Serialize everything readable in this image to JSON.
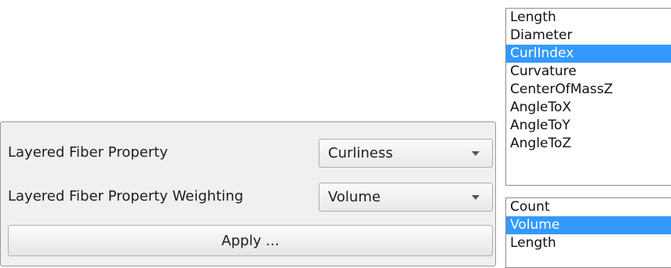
{
  "panel": {
    "property_label": "Layered Fiber Property",
    "property_value": "Curliness",
    "weighting_label": "Layered Fiber Property Weighting",
    "weighting_value": "Volume",
    "apply_label": "Apply ..."
  },
  "property_list": {
    "items": [
      "Length",
      "Diameter",
      "CurlIndex",
      "Curvature",
      "CenterOfMassZ",
      "AngleToX",
      "AngleToY",
      "AngleToZ"
    ],
    "selected": "CurlIndex"
  },
  "weighting_list": {
    "items": [
      "Count",
      "Volume",
      "Length"
    ],
    "selected": "Volume"
  },
  "colors": {
    "selection": "#3399ff",
    "panel_background": "#f0f0f0"
  },
  "icons": {
    "combo_arrow": "chevron-down-icon"
  }
}
